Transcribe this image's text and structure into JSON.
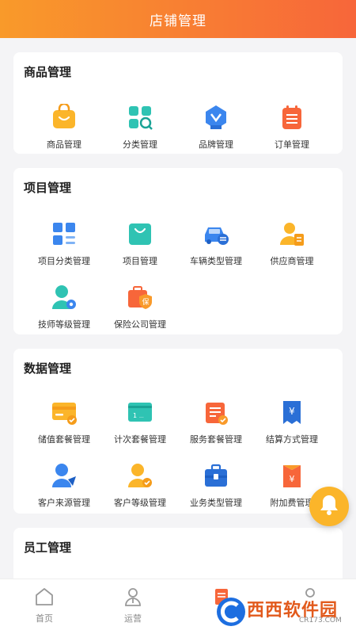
{
  "header": {
    "title": "店铺管理"
  },
  "sections": [
    {
      "title": "商品管理",
      "items": [
        {
          "label": "商品管理",
          "icon": "shopping-bag-icon"
        },
        {
          "label": "分类管理",
          "icon": "category-search-icon"
        },
        {
          "label": "品牌管理",
          "icon": "brand-badge-icon"
        },
        {
          "label": "订单管理",
          "icon": "order-list-icon"
        }
      ]
    },
    {
      "title": "项目管理",
      "items": [
        {
          "label": "项目分类管理",
          "icon": "grid-list-icon"
        },
        {
          "label": "项目管理",
          "icon": "bag-teal-icon"
        },
        {
          "label": "车辆类型管理",
          "icon": "car-icon"
        },
        {
          "label": "供应商管理",
          "icon": "supplier-user-icon"
        },
        {
          "label": "技师等级管理",
          "icon": "technician-gear-icon"
        },
        {
          "label": "保险公司管理",
          "icon": "insurance-case-icon"
        }
      ]
    },
    {
      "title": "数据管理",
      "items": [
        {
          "label": "储值套餐管理",
          "icon": "stored-value-card-icon"
        },
        {
          "label": "计次套餐管理",
          "icon": "count-card-icon"
        },
        {
          "label": "服务套餐管理",
          "icon": "service-package-icon"
        },
        {
          "label": "结算方式管理",
          "icon": "settlement-yen-icon"
        },
        {
          "label": "客户来源管理",
          "icon": "customer-source-icon"
        },
        {
          "label": "客户等级管理",
          "icon": "customer-level-icon"
        },
        {
          "label": "业务类型管理",
          "icon": "briefcase-icon"
        },
        {
          "label": "附加费管理",
          "icon": "surcharge-yen-icon"
        }
      ]
    },
    {
      "title": "员工管理",
      "items": []
    }
  ],
  "tabbar": [
    {
      "label": "首页",
      "icon": "home-icon"
    },
    {
      "label": "运营",
      "icon": "operation-user-icon"
    },
    {
      "label": "",
      "icon": "store-doc-icon"
    },
    {
      "label": "",
      "icon": "profile-icon"
    }
  ],
  "watermark": {
    "text": "西西软件园",
    "sub": "CR173.COM"
  },
  "colors": {
    "header_start": "#f99a2a",
    "header_end": "#f7663a",
    "bell": "#fbb52a"
  }
}
